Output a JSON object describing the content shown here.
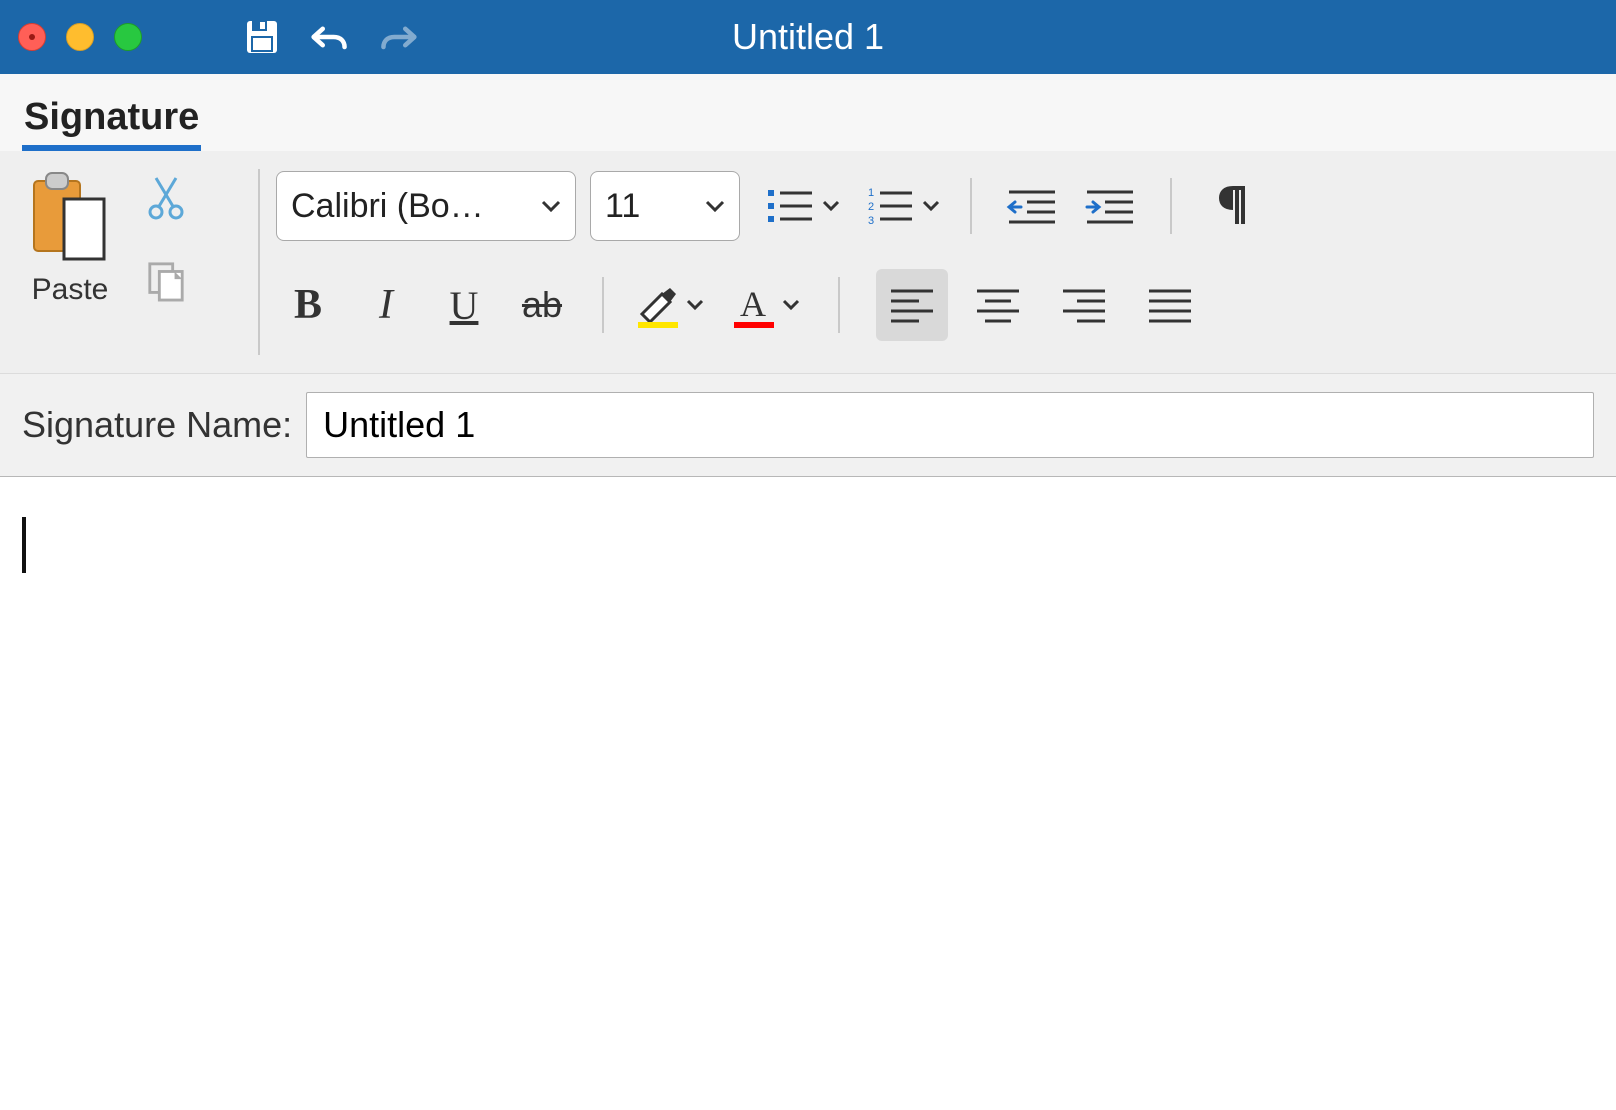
{
  "window": {
    "title": "Untitled 1"
  },
  "ribbon": {
    "tab_label": "Signature",
    "paste_label": "Paste",
    "font_name": "Calibri (Bo…",
    "font_size": "11"
  },
  "signature": {
    "label": "Signature Name:",
    "value": "Untitled 1"
  },
  "colors": {
    "accent": "#1c67a9",
    "highlight": "#ffe600",
    "font_color": "#ff0000"
  }
}
